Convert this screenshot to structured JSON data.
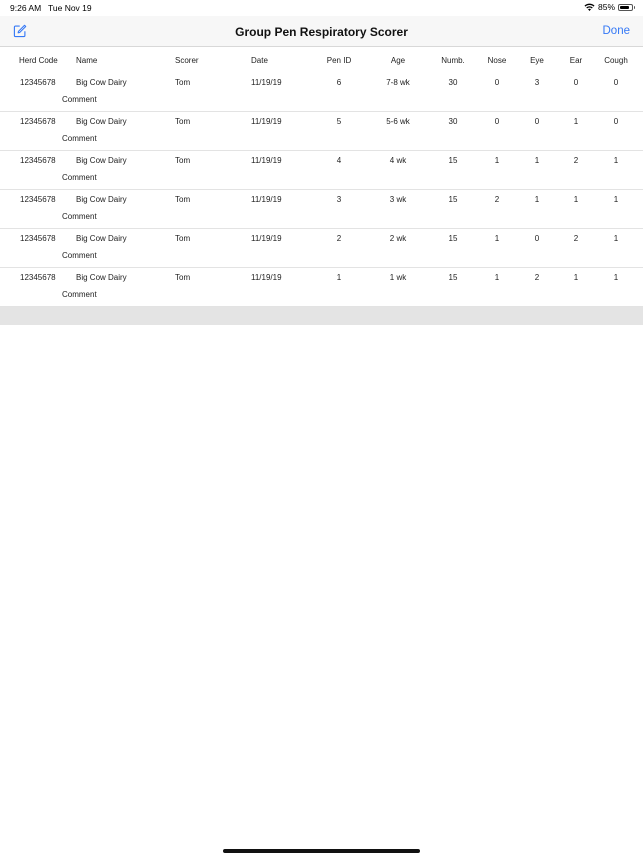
{
  "status_bar": {
    "time": "9:26 AM",
    "date": "Tue Nov 19",
    "battery": "85%",
    "battery_level": 0.85
  },
  "nav": {
    "title": "Group Pen Respiratory Scorer",
    "done_label": "Done",
    "accent_color": "#3478f6"
  },
  "columns": {
    "herd_code": "Herd Code",
    "name": "Name",
    "scorer": "Scorer",
    "date": "Date",
    "pen_id": "Pen ID",
    "age": "Age",
    "numb": "Numb.",
    "nose": "Nose",
    "eye": "Eye",
    "ear": "Ear",
    "cough": "Cough"
  },
  "rows": [
    {
      "herd_code": "12345678",
      "name": "Big Cow Dairy",
      "scorer": "Tom",
      "date": "11/19/19",
      "pen_id": "6",
      "age": "7-8 wk",
      "numb": "30",
      "nose": "0",
      "eye": "3",
      "ear": "0",
      "cough": "0",
      "comment": "Comment"
    },
    {
      "herd_code": "12345678",
      "name": "Big Cow Dairy",
      "scorer": "Tom",
      "date": "11/19/19",
      "pen_id": "5",
      "age": "5-6 wk",
      "numb": "30",
      "nose": "0",
      "eye": "0",
      "ear": "1",
      "cough": "0",
      "comment": "Comment"
    },
    {
      "herd_code": "12345678",
      "name": "Big Cow Dairy",
      "scorer": "Tom",
      "date": "11/19/19",
      "pen_id": "4",
      "age": "4 wk",
      "numb": "15",
      "nose": "1",
      "eye": "1",
      "ear": "2",
      "cough": "1",
      "comment": "Comment"
    },
    {
      "herd_code": "12345678",
      "name": "Big Cow Dairy",
      "scorer": "Tom",
      "date": "11/19/19",
      "pen_id": "3",
      "age": "3 wk",
      "numb": "15",
      "nose": "2",
      "eye": "1",
      "ear": "1",
      "cough": "1",
      "comment": "Comment"
    },
    {
      "herd_code": "12345678",
      "name": "Big Cow Dairy",
      "scorer": "Tom",
      "date": "11/19/19",
      "pen_id": "2",
      "age": "2 wk",
      "numb": "15",
      "nose": "1",
      "eye": "0",
      "ear": "2",
      "cough": "1",
      "comment": "Comment"
    },
    {
      "herd_code": "12345678",
      "name": "Big Cow Dairy",
      "scorer": "Tom",
      "date": "11/19/19",
      "pen_id": "1",
      "age": "1 wk",
      "numb": "15",
      "nose": "1",
      "eye": "2",
      "ear": "1",
      "cough": "1",
      "comment": "Comment"
    }
  ]
}
